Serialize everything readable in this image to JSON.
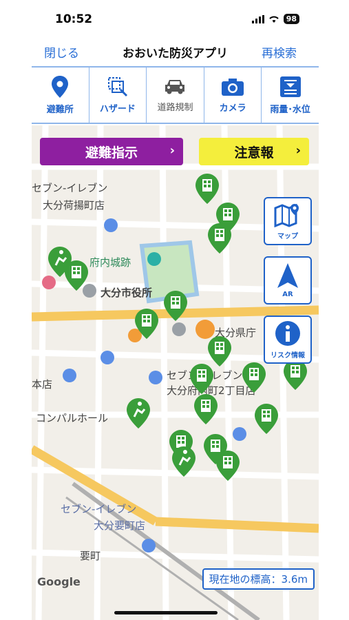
{
  "status": {
    "time": "10:52",
    "battery": "98"
  },
  "nav": {
    "close": "閉じる",
    "title": "おおいた防災アプリ",
    "search": "再検索"
  },
  "toolbar": {
    "items": [
      {
        "label": "避難所"
      },
      {
        "label": "ハザード"
      },
      {
        "label": "道路規制"
      },
      {
        "label": "カメラ"
      },
      {
        "label": "雨量･水位"
      }
    ]
  },
  "alerts": {
    "evacuation": "避難指示",
    "warning": "注意報"
  },
  "side_buttons": {
    "map": "マップ",
    "ar": "AR",
    "risk": "リスク情報"
  },
  "map_labels": {
    "seven_nishi": "セブン-イレブン",
    "seven_nishi_sub": "大分荷揚町店",
    "funai_castle": "府内城跡",
    "city_hall": "大分市役所",
    "pref_office": "大分県庁",
    "honten": "本店",
    "compal": "コンパルホール",
    "seven_funai": "セブン-イレブン",
    "seven_funai_sub": "大分府内町2丁目店",
    "seven_kaname": "セブン-イレブン",
    "seven_kaname_sub": "大分要町店",
    "kaname": "要町",
    "google": "Google",
    "elevation": "現在地の標高：3.6m"
  },
  "colors": {
    "accent": "#1f62c8",
    "evacuation": "#8e1fa0",
    "warning": "#f4ee3c",
    "shelter_pin": "#3a9e3a"
  }
}
